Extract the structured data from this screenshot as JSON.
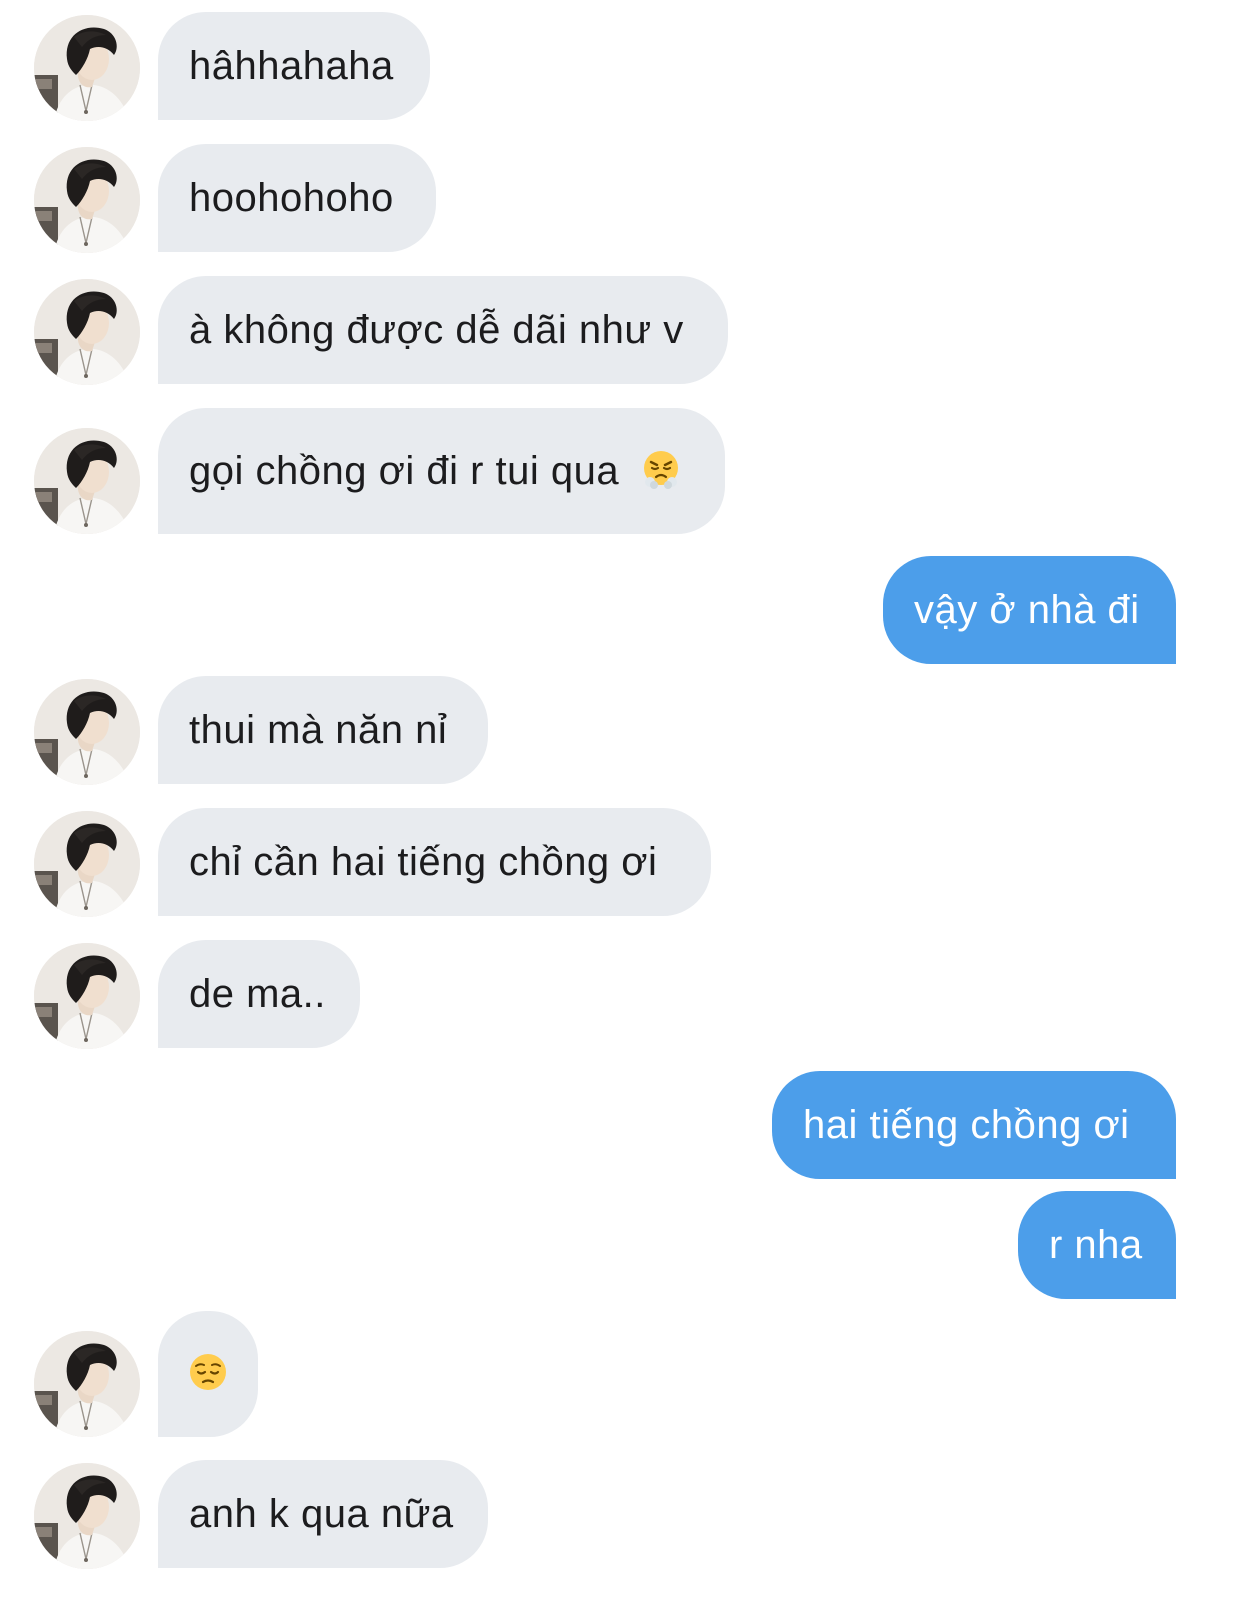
{
  "conversation": {
    "messages": [
      {
        "sender": "them",
        "text": "hâhhahaha"
      },
      {
        "sender": "them",
        "text": "hoohohoho"
      },
      {
        "sender": "them",
        "text": "à không được dễ dãi như v"
      },
      {
        "sender": "them",
        "text": "gọi chồng ơi đi r tui qua",
        "emoji": "steam-from-nose-emoji"
      },
      {
        "sender": "me",
        "text": "vậy ở nhà đi"
      },
      {
        "sender": "them",
        "text": "thui mà năn nỉ"
      },
      {
        "sender": "them",
        "text": "chỉ cần hai tiếng chồng ơi"
      },
      {
        "sender": "them",
        "text": "de ma.."
      },
      {
        "sender": "me",
        "text": "hai tiếng chồng ơi"
      },
      {
        "sender": "me",
        "text": "r nha"
      },
      {
        "sender": "them",
        "text": "",
        "emoji": "pensive-face-emoji"
      },
      {
        "sender": "them",
        "text": "anh k qua nữa"
      }
    ]
  },
  "colors": {
    "incoming_bubble": "#e8ebef",
    "outgoing_bubble": "#4c9eea",
    "incoming_text": "#1c1c1e",
    "outgoing_text": "#ffffff",
    "background": "#ffffff"
  }
}
